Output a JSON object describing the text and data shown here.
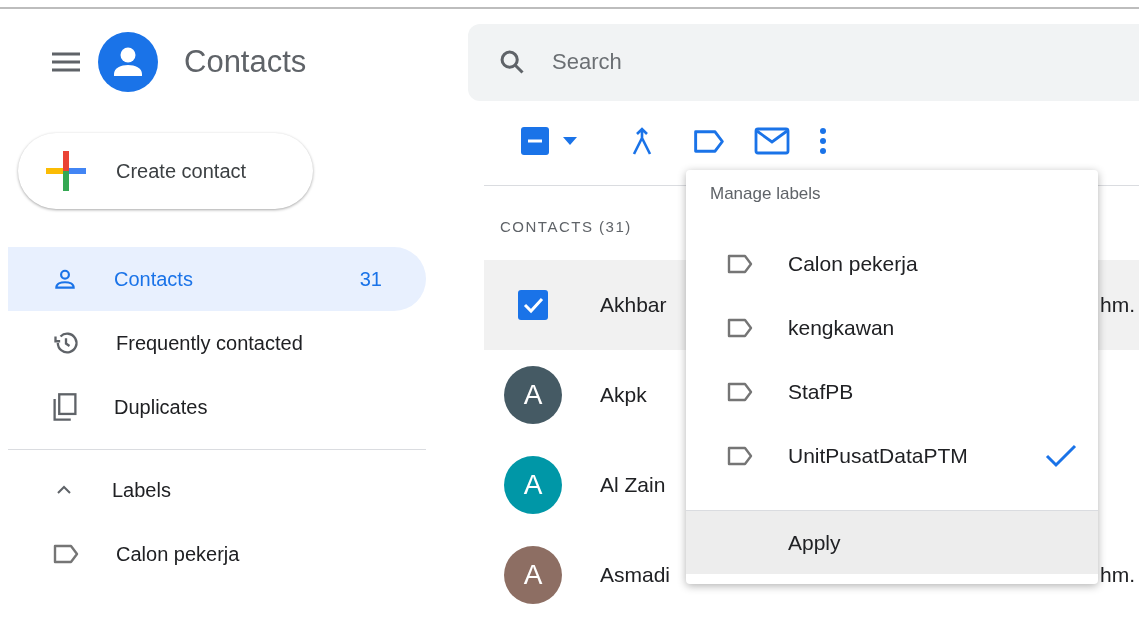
{
  "app": {
    "title": "Contacts"
  },
  "search": {
    "placeholder": "Search"
  },
  "create_button": {
    "label": "Create contact"
  },
  "nav": [
    {
      "kind": "person",
      "label": "Contacts",
      "count": "31",
      "selected": true
    },
    {
      "kind": "history",
      "label": "Frequently contacted",
      "selected": false
    },
    {
      "kind": "copy",
      "label": "Duplicates",
      "selected": false
    }
  ],
  "labels_section": {
    "title": "Labels",
    "expanded": true,
    "items": [
      {
        "label": "Calon pekerja"
      }
    ]
  },
  "toolbar": {
    "select_checked": true,
    "select_partial": true
  },
  "contacts_heading": "CONTACTS (31)",
  "contacts": [
    {
      "name": "Akhbar",
      "checked": true,
      "selected": true,
      "email_fragment": "hm."
    },
    {
      "name": "Akpk",
      "initial": "A",
      "color": "#455a64",
      "checked": false,
      "selected": false
    },
    {
      "name": "Al Zain",
      "initial": "A",
      "color": "#0097a7",
      "checked": false,
      "selected": false
    },
    {
      "name": "Asmadi",
      "initial": "A",
      "color": "#8d6e63",
      "checked": false,
      "selected": false,
      "email_fragment": "hm."
    }
  ],
  "menu": {
    "title": "Manage labels",
    "items": [
      {
        "label": "Calon pekerja",
        "checked": false
      },
      {
        "label": "kengkawan",
        "checked": false
      },
      {
        "label": "StafPB",
        "checked": false
      },
      {
        "label": "UnitPusatDataPTM",
        "checked": true
      }
    ],
    "apply": "Apply"
  }
}
